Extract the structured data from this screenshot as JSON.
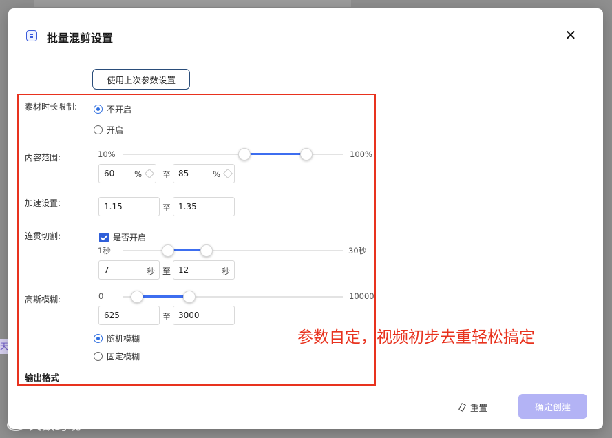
{
  "dialog": {
    "title": "批量混剪设置",
    "close_glyph": "✕",
    "use_last_params": "使用上次参数设置"
  },
  "material_duration": {
    "label": "素材时长限制:",
    "options": [
      "不开启",
      "开启"
    ],
    "selected": "不开启"
  },
  "content_range": {
    "label": "内容范围:",
    "min_label": "10%",
    "max_label": "100%",
    "from": "60",
    "to": "85",
    "unit": "%",
    "separator": "至"
  },
  "speed": {
    "label": "加速设置:",
    "from": "1.15",
    "to": "1.35",
    "separator": "至"
  },
  "coherent_cut": {
    "label": "连贯切割:",
    "checkbox_label": "是否开启",
    "checked": true,
    "min_label": "1秒",
    "max_label": "30秒",
    "from": "7",
    "to": "12",
    "unit": "秒",
    "separator": "至"
  },
  "gaussian_blur": {
    "label": "高斯模糊:",
    "min_label": "0",
    "max_label": "10000",
    "from": "625",
    "to": "3000",
    "separator": "至",
    "options": [
      "随机模糊",
      "固定模糊"
    ],
    "selected": "随机模糊"
  },
  "output_format": {
    "heading": "输出格式"
  },
  "annotation": "参数自定，视频初步去重轻松搞定",
  "footer": {
    "reset": "重置",
    "confirm": "确定创建"
  },
  "background": {
    "edge_text": "天"
  },
  "watermark": "大数跨境",
  "colors": {
    "accent": "#3d6ef0",
    "highlight": "#e8321e",
    "confirm_bg": "#b3b3f5"
  },
  "icons": {
    "header": "list-doc-icon",
    "close": "close-icon",
    "reset": "eraser-icon"
  }
}
